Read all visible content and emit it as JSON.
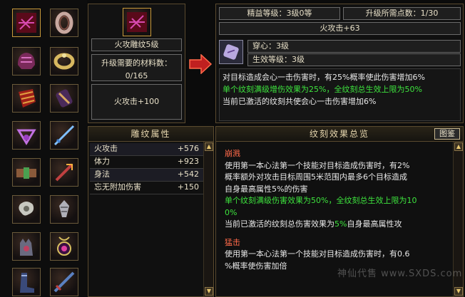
{
  "refine_level": "精益等级：3级0等",
  "upgrade_points": "升级所需点数：1/30",
  "item_name": "火攻雕纹5级",
  "material_label": "升级需要的材料数：",
  "material_count": "0/165",
  "item_stat": "火攻击+100",
  "result_title": "火攻击+63",
  "result_slot1": "穿心：3级",
  "result_slot2": "生效等级：3级",
  "desc": {
    "line1": "对目标造成会心一击伤害时，有25%概率使此伤害增加6%",
    "line2": "单个纹刻满级增伤效果为25%，全纹刻总生效上限为50%",
    "line3": "当前已激活的纹刻共使会心一击伤害增加6%"
  },
  "attr_panel_title": "雕纹属性",
  "attributes": [
    {
      "name": "火攻击",
      "value": "+576"
    },
    {
      "name": "体力",
      "value": "+923"
    },
    {
      "name": "身法",
      "value": "+542"
    },
    {
      "name": "忘无附加伤害",
      "value": "+150"
    }
  ],
  "effects_title": "纹刻效果总览",
  "effects_tab": "图鉴",
  "effect1": {
    "name": "崩溅",
    "l1": "使用第一本心法第一个技能对目标造成伤害时，有2%",
    "l2": "概率额外对攻击目标周围5米范围内最多6个目标造成",
    "l3": "自身最高属性5%的伤害",
    "l4": "单个纹刻满级伤害效果为50%，全纹刻总生效上限为10",
    "l5": "0%",
    "l6a": "当前已激活的纹刻总伤害效果为",
    "l6b": "5%",
    "l6c": "自身最高属性攻"
  },
  "effect2": {
    "name": "猛击",
    "l1": "使用第一本心法第一个技能对目标造成伤害时，有0.6",
    "l2": "%概率使伤害加倍"
  },
  "watermark": "神仙代售 www.SXDS.com",
  "colors": {
    "accent_green": "#3de33d",
    "accent_red": "#ff6a4a",
    "gold_border": "#5a4a2e"
  }
}
